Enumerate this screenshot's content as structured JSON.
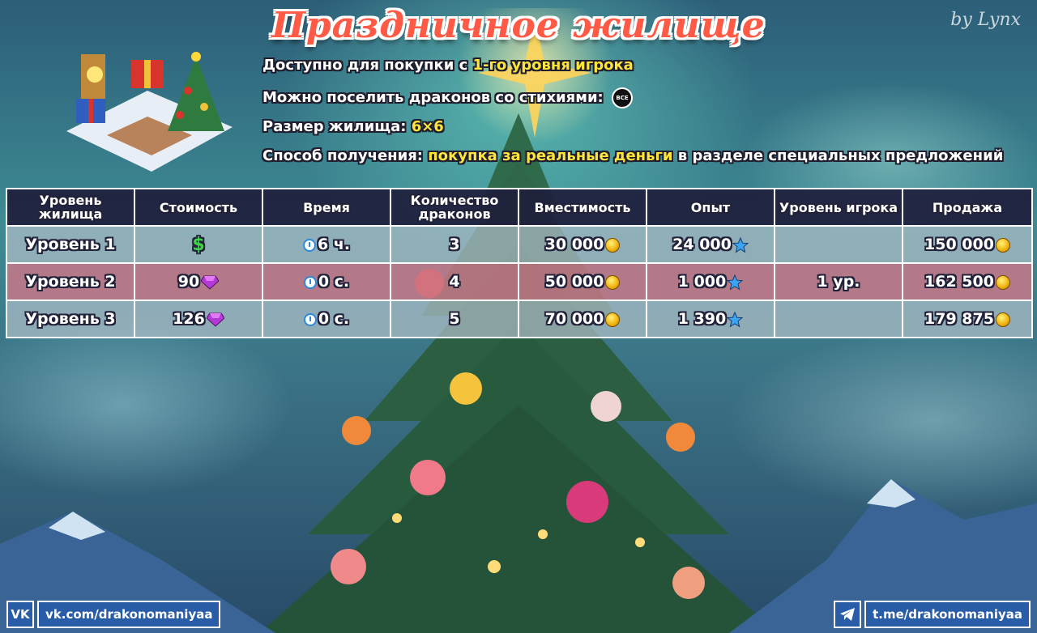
{
  "header": {
    "title": "Праздничное жилище",
    "author": "by Lynx"
  },
  "info": {
    "line1_prefix": "Доступно для покупки с ",
    "line1_value": "1-го уровня игрока",
    "line2_prefix": "Можно поселить драконов со стихиями: ",
    "line2_badge": "ВСЕ",
    "line3_prefix": "Размер жилища: ",
    "line3_value": "6×6",
    "line4_prefix": "Способ получения: ",
    "line4_value": "покупка за реальные деньги",
    "line4_suffix": " в разделе специальных предложений"
  },
  "table": {
    "headers": [
      "Уровень жилища",
      "Стоимость",
      "Время",
      "Количество драконов",
      "Вместимость",
      "Опыт",
      "Уровень игрока",
      "Продажа"
    ],
    "rows": [
      {
        "level": "Уровень 1",
        "cost": "$",
        "time": "6 ч.",
        "dragons": "3",
        "capacity": "30 000",
        "xp": "24 000",
        "player_level": "",
        "sale": "150 000"
      },
      {
        "level": "Уровень 2",
        "cost": "90",
        "time": "0 с.",
        "dragons": "4",
        "capacity": "50 000",
        "xp": "1 000",
        "player_level": "1 ур.",
        "sale": "162 500"
      },
      {
        "level": "Уровень 3",
        "cost": "126",
        "time": "0 с.",
        "dragons": "5",
        "capacity": "70 000",
        "xp": "1 390",
        "player_level": "",
        "sale": "179 875"
      }
    ]
  },
  "footer": {
    "vk_icon": "vk-icon",
    "vk_label": "vk.com/drakonomaniyaa",
    "tg_icon": "telegram-icon",
    "tg_label": "t.me/drakonomaniyaa"
  },
  "colors": {
    "title": "#ff5a45",
    "highlight": "#ffe53a",
    "row_highlight": "#cd7887",
    "header_bg": "#1e1e3c"
  }
}
